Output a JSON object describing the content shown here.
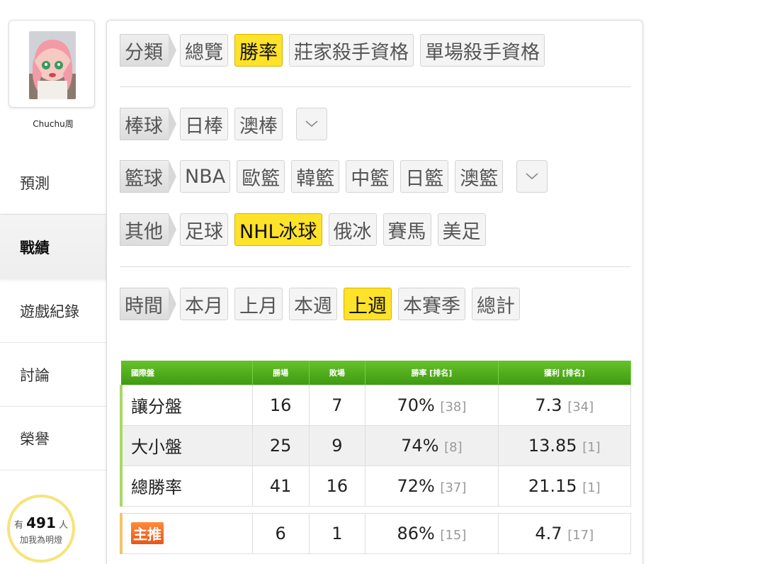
{
  "user": {
    "name": "Chuchu周"
  },
  "nav": [
    {
      "label": "預測"
    },
    {
      "label": "戰績"
    },
    {
      "label": "遊戲紀錄"
    },
    {
      "label": "討論"
    },
    {
      "label": "榮譽"
    }
  ],
  "fans": {
    "prefix": "有",
    "count": "491",
    "suffix": "人",
    "line2": "加我為明燈"
  },
  "filters": {
    "category": {
      "label": "分類",
      "chips": [
        "總覽",
        "勝率",
        "莊家殺手資格",
        "單場殺手資格"
      ],
      "active": 1
    },
    "baseball": {
      "label": "棒球",
      "chips": [
        "日棒",
        "澳棒"
      ]
    },
    "basketball": {
      "label": "籃球",
      "chips": [
        "NBA",
        "歐籃",
        "韓籃",
        "中籃",
        "日籃",
        "澳籃"
      ]
    },
    "other": {
      "label": "其他",
      "chips": [
        "足球",
        "NHL冰球",
        "俄冰",
        "賽馬",
        "美足"
      ],
      "active": 1
    },
    "time": {
      "label": "時間",
      "chips": [
        "本月",
        "上月",
        "本週",
        "上週",
        "本賽季",
        "總計"
      ],
      "active": 3
    }
  },
  "table": {
    "headers": [
      "國際盤",
      "勝場",
      "敗場",
      "勝率 [排名]",
      "獲利 [排名]"
    ],
    "rows": [
      {
        "name": "讓分盤",
        "win": "16",
        "loss": "7",
        "rate": "70%",
        "rate_rank": "[38]",
        "profit": "7.3",
        "profit_rank": "[34]"
      },
      {
        "name": "大小盤",
        "win": "25",
        "loss": "9",
        "rate": "74%",
        "rate_rank": "[8]",
        "profit": "13.85",
        "profit_rank": "[1]"
      },
      {
        "name": "總勝率",
        "win": "41",
        "loss": "16",
        "rate": "72%",
        "rate_rank": "[37]",
        "profit": "21.15",
        "profit_rank": "[1]"
      }
    ],
    "main": {
      "name": "主推",
      "win": "6",
      "loss": "1",
      "rate": "86%",
      "rate_rank": "[15]",
      "profit": "4.7",
      "profit_rank": "[17]"
    }
  },
  "colors": {
    "active_chip": "#ffe22a",
    "table_header": "#4fae1c",
    "main_badge": "#f06a22"
  }
}
